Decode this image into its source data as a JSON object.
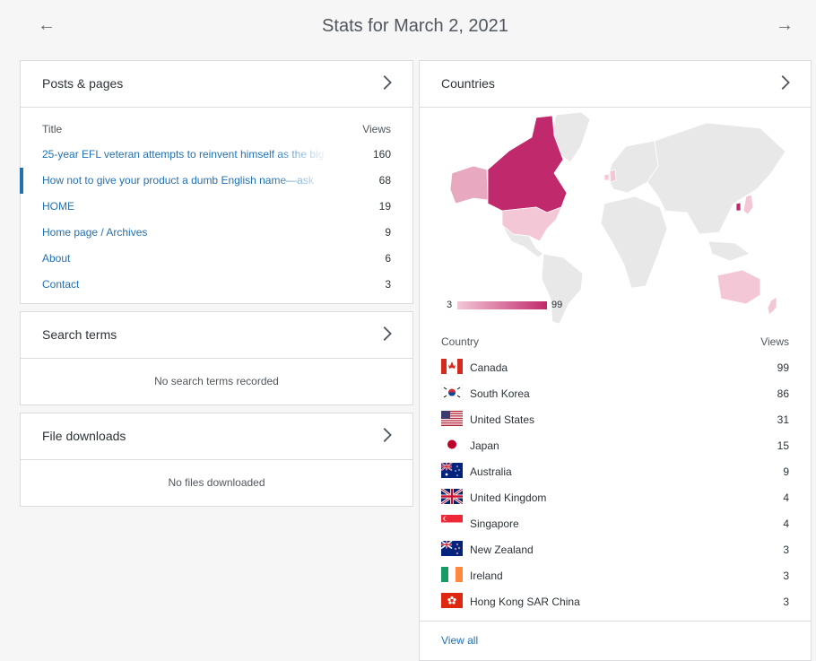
{
  "header": {
    "title": "Stats for March 2, 2021",
    "prev_icon": "arrow-left-icon",
    "next_icon": "arrow-right-icon"
  },
  "posts": {
    "title": "Posts & pages",
    "col_title": "Title",
    "col_views": "Views",
    "rows": [
      {
        "label": "25-year EFL veteran attempts to reinvent himself as the big",
        "views": "160"
      },
      {
        "label": "How not to give your product a dumb English name—ask",
        "views": "68"
      },
      {
        "label": "HOME",
        "views": "19"
      },
      {
        "label": "Home page / Archives",
        "views": "9"
      },
      {
        "label": "About",
        "views": "6"
      },
      {
        "label": "Contact",
        "views": "3"
      }
    ]
  },
  "search": {
    "title": "Search terms",
    "empty": "No search terms recorded"
  },
  "files": {
    "title": "File downloads",
    "empty": "No files downloaded"
  },
  "countries": {
    "title": "Countries",
    "legend_min": "3",
    "legend_max": "99",
    "col_country": "Country",
    "col_views": "Views",
    "rows": [
      {
        "name": "Canada",
        "views": "99"
      },
      {
        "name": "South Korea",
        "views": "86"
      },
      {
        "name": "United States",
        "views": "31"
      },
      {
        "name": "Japan",
        "views": "15"
      },
      {
        "name": "Australia",
        "views": "9"
      },
      {
        "name": "United Kingdom",
        "views": "4"
      },
      {
        "name": "Singapore",
        "views": "4"
      },
      {
        "name": "New Zealand",
        "views": "3"
      },
      {
        "name": "Ireland",
        "views": "3"
      },
      {
        "name": "Hong Kong SAR China",
        "views": "3"
      }
    ],
    "view_all": "View all"
  },
  "colors": {
    "link": "#2271b1",
    "map_high": "#c0296b",
    "map_low": "#f3c7d6",
    "map_empty": "#e8e8e8"
  }
}
